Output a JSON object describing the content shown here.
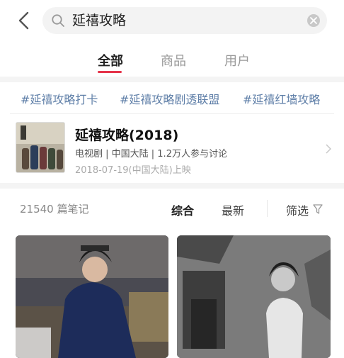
{
  "search": {
    "query": "延禧攻略"
  },
  "tabs": [
    {
      "label": "全部",
      "active": true
    },
    {
      "label": "商品",
      "active": false
    },
    {
      "label": "用户",
      "active": false
    }
  ],
  "topics": [
    "#延禧攻略打卡",
    "#延禧攻略剧透联盟",
    "#延禧红墙攻略"
  ],
  "card": {
    "title": "延禧攻略(2018)",
    "meta": "电视剧 | 中国大陆 | 1.2万人参与讨论",
    "date": "2018-07-19(中国大陆)上映"
  },
  "notes": {
    "count": "21540 篇笔记",
    "sort_comprehensive": "综合",
    "sort_latest": "最新",
    "filter_label": "筛选"
  },
  "colors": {
    "accent": "#e5344a",
    "topic": "#5f7fa8"
  }
}
